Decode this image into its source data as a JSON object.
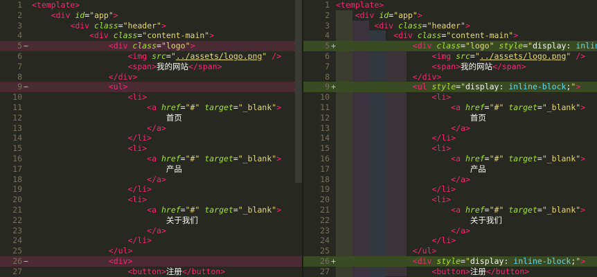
{
  "left": {
    "lines": [
      {
        "n": "1",
        "mark": "",
        "type": "",
        "html": "<span class=\"c-kw\">&lt;template&gt;</span>"
      },
      {
        "n": "2",
        "mark": "",
        "type": "",
        "html": "    <span class=\"c-kw\">&lt;div</span> <span class=\"c-attr\">id</span><span class=\"c-eq\">=</span><span class=\"c-str\">\"app\"</span><span class=\"c-kw\">&gt;</span>"
      },
      {
        "n": "3",
        "mark": "",
        "type": "",
        "html": "        <span class=\"c-kw\">&lt;div</span> <span class=\"c-attr\">class</span><span class=\"c-eq\">=</span><span class=\"c-str\">\"header\"</span><span class=\"c-kw\">&gt;</span>"
      },
      {
        "n": "4",
        "mark": "",
        "type": "",
        "html": "            <span class=\"c-kw\">&lt;div</span> <span class=\"c-attr\">class</span><span class=\"c-eq\">=</span><span class=\"c-str\">\"content-main\"</span><span class=\"c-kw\">&gt;</span>"
      },
      {
        "n": "5",
        "mark": "−",
        "type": "del",
        "html": "                <span class=\"c-kw\">&lt;div</span> <span class=\"c-attr\">class</span><span class=\"c-eq\">=</span><span class=\"c-str\">\"logo\"</span><span class=\"c-kw\">&gt;</span>"
      },
      {
        "n": "6",
        "mark": "",
        "type": "",
        "html": "                    <span class=\"c-kw\">&lt;img</span> <span class=\"c-attr\">src</span><span class=\"c-eq\">=</span><span class=\"c-str\">\"</span><span class=\"c-link\">../assets/logo.png</span><span class=\"c-str\">\"</span> <span class=\"c-kw\">/&gt;</span>"
      },
      {
        "n": "7",
        "mark": "",
        "type": "",
        "html": "                    <span class=\"c-kw\">&lt;span&gt;</span><span class=\"c-txt\">我的网站</span><span class=\"c-kw\">&lt;/span&gt;</span>"
      },
      {
        "n": "8",
        "mark": "",
        "type": "",
        "html": "                <span class=\"c-kw\">&lt;/div&gt;</span>"
      },
      {
        "n": "9",
        "mark": "−",
        "type": "del",
        "html": "                <span class=\"c-kw\">&lt;ul&gt;</span>"
      },
      {
        "n": "10",
        "mark": "",
        "type": "",
        "html": "                    <span class=\"c-kw\">&lt;li&gt;</span>"
      },
      {
        "n": "11",
        "mark": "",
        "type": "",
        "html": "                        <span class=\"c-kw\">&lt;a</span> <span class=\"c-attr\">href</span><span class=\"c-eq\">=</span><span class=\"c-str\">\"#\"</span> <span class=\"c-attr\">target</span><span class=\"c-eq\">=</span><span class=\"c-str\">\"_blank\"</span><span class=\"c-kw\">&gt;</span>"
      },
      {
        "n": "12",
        "mark": "",
        "type": "",
        "html": "                            <span class=\"c-txt\">首页</span>"
      },
      {
        "n": "13",
        "mark": "",
        "type": "",
        "html": "                        <span class=\"c-kw\">&lt;/a&gt;</span>"
      },
      {
        "n": "14",
        "mark": "",
        "type": "",
        "html": "                    <span class=\"c-kw\">&lt;/li&gt;</span>"
      },
      {
        "n": "15",
        "mark": "",
        "type": "",
        "html": "                    <span class=\"c-kw\">&lt;li&gt;</span>"
      },
      {
        "n": "16",
        "mark": "",
        "type": "",
        "html": "                        <span class=\"c-kw\">&lt;a</span> <span class=\"c-attr\">href</span><span class=\"c-eq\">=</span><span class=\"c-str\">\"#\"</span> <span class=\"c-attr\">target</span><span class=\"c-eq\">=</span><span class=\"c-str\">\"_blank\"</span><span class=\"c-kw\">&gt;</span>"
      },
      {
        "n": "17",
        "mark": "",
        "type": "",
        "html": "                            <span class=\"c-txt\">产品</span>"
      },
      {
        "n": "18",
        "mark": "",
        "type": "",
        "html": "                        <span class=\"c-kw\">&lt;/a&gt;</span>"
      },
      {
        "n": "19",
        "mark": "",
        "type": "",
        "html": "                    <span class=\"c-kw\">&lt;/li&gt;</span>"
      },
      {
        "n": "20",
        "mark": "",
        "type": "",
        "html": "                    <span class=\"c-kw\">&lt;li&gt;</span>"
      },
      {
        "n": "21",
        "mark": "",
        "type": "",
        "html": "                        <span class=\"c-kw\">&lt;a</span> <span class=\"c-attr\">href</span><span class=\"c-eq\">=</span><span class=\"c-str\">\"#\"</span> <span class=\"c-attr\">target</span><span class=\"c-eq\">=</span><span class=\"c-str\">\"_blank\"</span><span class=\"c-kw\">&gt;</span>"
      },
      {
        "n": "22",
        "mark": "",
        "type": "",
        "html": "                            <span class=\"c-txt\">关于我们</span>"
      },
      {
        "n": "23",
        "mark": "",
        "type": "",
        "html": "                        <span class=\"c-kw\">&lt;/a&gt;</span>"
      },
      {
        "n": "24",
        "mark": "",
        "type": "",
        "html": "                    <span class=\"c-kw\">&lt;/li&gt;</span>"
      },
      {
        "n": "25",
        "mark": "",
        "type": "",
        "html": "                <span class=\"c-kw\">&lt;/ul&gt;</span>"
      },
      {
        "n": "26",
        "mark": "−",
        "type": "del",
        "html": "                <span class=\"c-kw\">&lt;div&gt;</span>"
      },
      {
        "n": "27",
        "mark": "",
        "type": "",
        "html": "                    <span class=\"c-kw\">&lt;button&gt;</span><span class=\"c-txt\">注册</span><span class=\"c-kw\">&lt;/button&gt;</span>"
      }
    ]
  },
  "right": {
    "lines": [
      {
        "n": "1",
        "mark": "",
        "arrow": "",
        "type": "",
        "html": "<span class=\"c-kw\">&lt;template&gt;</span>"
      },
      {
        "n": "2",
        "mark": "",
        "arrow": "",
        "type": "",
        "html": "    <span class=\"c-kw\">&lt;div</span> <span class=\"c-attr\">id</span><span class=\"c-eq\">=</span><span class=\"c-str\">\"app\"</span><span class=\"c-kw\">&gt;</span>"
      },
      {
        "n": "3",
        "mark": "",
        "arrow": "",
        "type": "",
        "html": "        <span class=\"c-kw\">&lt;div</span> <span class=\"c-attr\">class</span><span class=\"c-eq\">=</span><span class=\"c-str\">\"header\"</span><span class=\"c-kw\">&gt;</span>"
      },
      {
        "n": "4",
        "mark": "",
        "arrow": "",
        "type": "",
        "html": "            <span class=\"c-kw\">&lt;div</span> <span class=\"c-attr\">class</span><span class=\"c-eq\">=</span><span class=\"c-str\">\"content-main\"</span><span class=\"c-kw\">&gt;</span>"
      },
      {
        "n": "5",
        "mark": "+",
        "arrow": "→",
        "type": "add",
        "html": "                <span class=\"c-kw\">&lt;div</span> <span class=\"c-attr\">class</span><span class=\"c-eq\">=</span><span class=\"c-str\">\"logo\"</span> <span class=\"c-attr\">style</span><span class=\"c-eq\">=</span><span class=\"c-str\">\"</span><span class=\"c-txt\">display</span><span class=\"c-eq\">:</span> <span class=\"c-prop\">inline-bl</span>"
      },
      {
        "n": "6",
        "mark": "",
        "arrow": "",
        "type": "",
        "html": "                    <span class=\"c-kw\">&lt;img</span> <span class=\"c-attr\">src</span><span class=\"c-eq\">=</span><span class=\"c-str\">\"</span><span class=\"c-link\">../assets/logo.png</span><span class=\"c-str\">\"</span> <span class=\"c-kw\">/&gt;</span>"
      },
      {
        "n": "7",
        "mark": "",
        "arrow": "",
        "type": "",
        "html": "                    <span class=\"c-kw\">&lt;span&gt;</span><span class=\"c-txt\">我的网站</span><span class=\"c-kw\">&lt;/span&gt;</span>"
      },
      {
        "n": "8",
        "mark": "",
        "arrow": "",
        "type": "",
        "html": "                <span class=\"c-kw\">&lt;/div&gt;</span>"
      },
      {
        "n": "9",
        "mark": "+",
        "arrow": "→",
        "type": "add",
        "html": "                <span class=\"c-kw\">&lt;ul</span> <span class=\"c-attr\">style</span><span class=\"c-eq\">=</span><span class=\"c-str\">\"</span><span class=\"c-txt\">display</span><span class=\"c-eq\">:</span> <span class=\"c-prop\">inline-block</span><span class=\"c-eq\">;</span><span class=\"c-str\">\"</span><span class=\"c-kw\">&gt;</span>"
      },
      {
        "n": "10",
        "mark": "",
        "arrow": "",
        "type": "",
        "html": "                    <span class=\"c-kw\">&lt;li&gt;</span>"
      },
      {
        "n": "11",
        "mark": "",
        "arrow": "",
        "type": "",
        "html": "                        <span class=\"c-kw\">&lt;a</span> <span class=\"c-attr\">href</span><span class=\"c-eq\">=</span><span class=\"c-str\">\"#\"</span> <span class=\"c-attr\">target</span><span class=\"c-eq\">=</span><span class=\"c-str\">\"_blank\"</span><span class=\"c-kw\">&gt;</span>"
      },
      {
        "n": "12",
        "mark": "",
        "arrow": "",
        "type": "",
        "html": "                            <span class=\"c-txt\">首页</span>"
      },
      {
        "n": "13",
        "mark": "",
        "arrow": "",
        "type": "",
        "html": "                        <span class=\"c-kw\">&lt;/a&gt;</span>"
      },
      {
        "n": "14",
        "mark": "",
        "arrow": "",
        "type": "",
        "html": "                    <span class=\"c-kw\">&lt;/li&gt;</span>"
      },
      {
        "n": "15",
        "mark": "",
        "arrow": "",
        "type": "",
        "html": "                    <span class=\"c-kw\">&lt;li&gt;</span>"
      },
      {
        "n": "16",
        "mark": "",
        "arrow": "",
        "type": "",
        "html": "                        <span class=\"c-kw\">&lt;a</span> <span class=\"c-attr\">href</span><span class=\"c-eq\">=</span><span class=\"c-str\">\"#\"</span> <span class=\"c-attr\">target</span><span class=\"c-eq\">=</span><span class=\"c-str\">\"_blank\"</span><span class=\"c-kw\">&gt;</span>"
      },
      {
        "n": "17",
        "mark": "",
        "arrow": "",
        "type": "",
        "html": "                            <span class=\"c-txt\">产品</span>"
      },
      {
        "n": "18",
        "mark": "",
        "arrow": "",
        "type": "",
        "html": "                        <span class=\"c-kw\">&lt;/a&gt;</span>"
      },
      {
        "n": "19",
        "mark": "",
        "arrow": "",
        "type": "",
        "html": "                    <span class=\"c-kw\">&lt;/li&gt;</span>"
      },
      {
        "n": "20",
        "mark": "",
        "arrow": "",
        "type": "",
        "html": "                    <span class=\"c-kw\">&lt;li&gt;</span>"
      },
      {
        "n": "21",
        "mark": "",
        "arrow": "",
        "type": "",
        "html": "                        <span class=\"c-kw\">&lt;a</span> <span class=\"c-attr\">href</span><span class=\"c-eq\">=</span><span class=\"c-str\">\"#\"</span> <span class=\"c-attr\">target</span><span class=\"c-eq\">=</span><span class=\"c-str\">\"_blank\"</span><span class=\"c-kw\">&gt;</span>"
      },
      {
        "n": "22",
        "mark": "",
        "arrow": "",
        "type": "",
        "html": "                            <span class=\"c-txt\">关于我们</span>"
      },
      {
        "n": "23",
        "mark": "",
        "arrow": "",
        "type": "",
        "html": "                        <span class=\"c-kw\">&lt;/a&gt;</span>"
      },
      {
        "n": "24",
        "mark": "",
        "arrow": "",
        "type": "",
        "html": "                    <span class=\"c-kw\">&lt;/li&gt;</span>"
      },
      {
        "n": "25",
        "mark": "",
        "arrow": "",
        "type": "",
        "html": "                <span class=\"c-kw\">&lt;/ul&gt;</span>"
      },
      {
        "n": "26",
        "mark": "+",
        "arrow": "→",
        "type": "add",
        "html": "                <span class=\"c-kw\">&lt;div</span> <span class=\"c-attr\">style</span><span class=\"c-eq\">=</span><span class=\"c-str\">\"</span><span class=\"c-txt\">display</span><span class=\"c-eq\">:</span> <span class=\"c-prop\">inline-block</span><span class=\"c-eq\">;</span><span class=\"c-str\">\"</span><span class=\"c-kw\">&gt;</span>"
      },
      {
        "n": "27",
        "mark": "",
        "arrow": "",
        "type": "",
        "html": "                    <span class=\"c-kw\">&lt;button&gt;</span><span class=\"c-txt\">注册</span><span class=\"c-kw\">&lt;/button&gt;</span>"
      }
    ]
  },
  "colors": {
    "background": "#272822",
    "deleted_line": "#4a2a33",
    "added_line": "#3a4a22",
    "tag": "#f92672",
    "attribute": "#a6e22e",
    "string": "#e6db74",
    "property": "#66d9ef"
  },
  "icons": {
    "arrow": "arrow-right-icon"
  }
}
